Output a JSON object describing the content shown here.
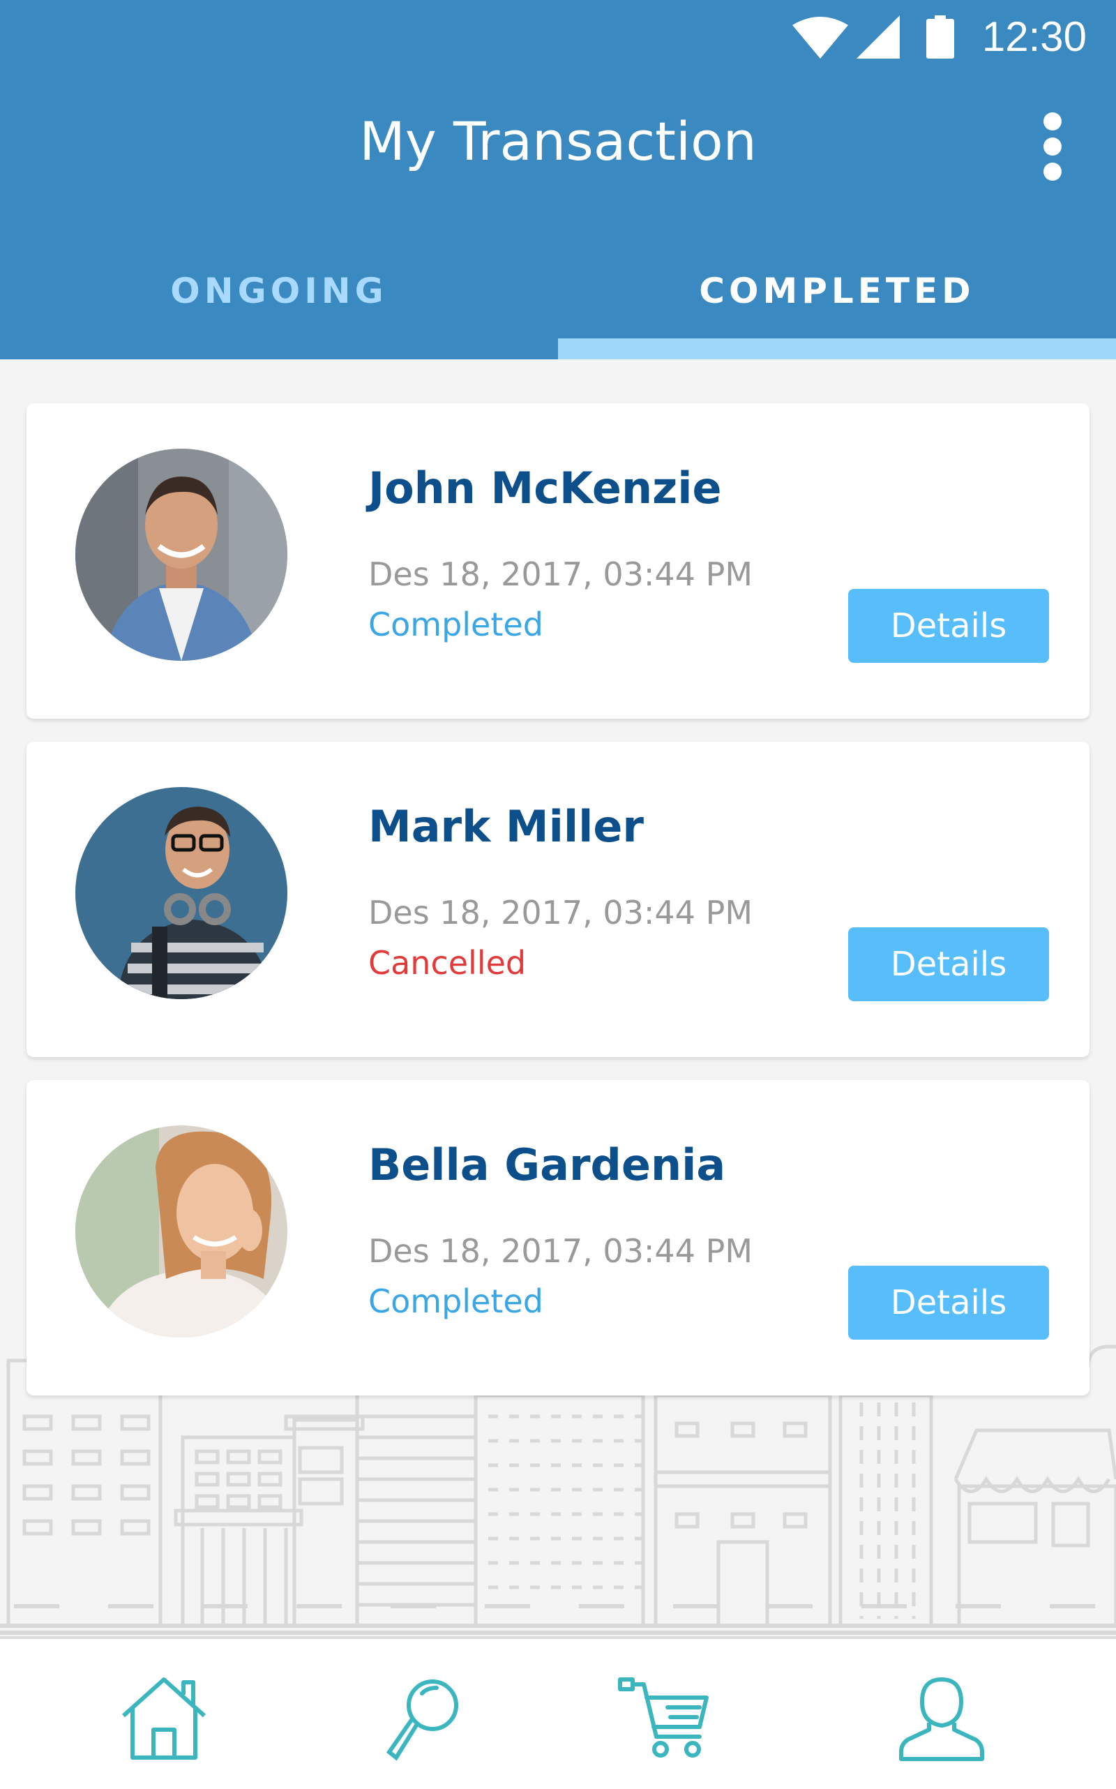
{
  "status_bar": {
    "time": "12:30"
  },
  "header": {
    "title": "My Transaction"
  },
  "tabs": [
    {
      "label": "ONGOING"
    },
    {
      "label": "COMPLETED"
    }
  ],
  "transactions": [
    {
      "name": "John McKenzie",
      "date": "Des 18, 2017, 03:44 PM",
      "status": "Completed",
      "status_color": "#3aa6e6",
      "button": "Details"
    },
    {
      "name": "Mark Miller",
      "date": "Des 18, 2017, 03:44 PM",
      "status": "Cancelled",
      "status_color": "#e23a3a",
      "button": "Details"
    },
    {
      "name": "Bella Gardenia",
      "date": "Des 18, 2017, 03:44 PM",
      "status": "Completed",
      "status_color": "#3aa6e6",
      "button": "Details"
    }
  ],
  "colors": {
    "header": "#3a89c0",
    "accent": "#58bdfb",
    "name": "#0d4f8a",
    "nav_icon": "#3bb6bf"
  },
  "bottom_nav": [
    {
      "icon": "home-icon"
    },
    {
      "icon": "search-icon"
    },
    {
      "icon": "cart-icon"
    },
    {
      "icon": "user-icon"
    }
  ]
}
